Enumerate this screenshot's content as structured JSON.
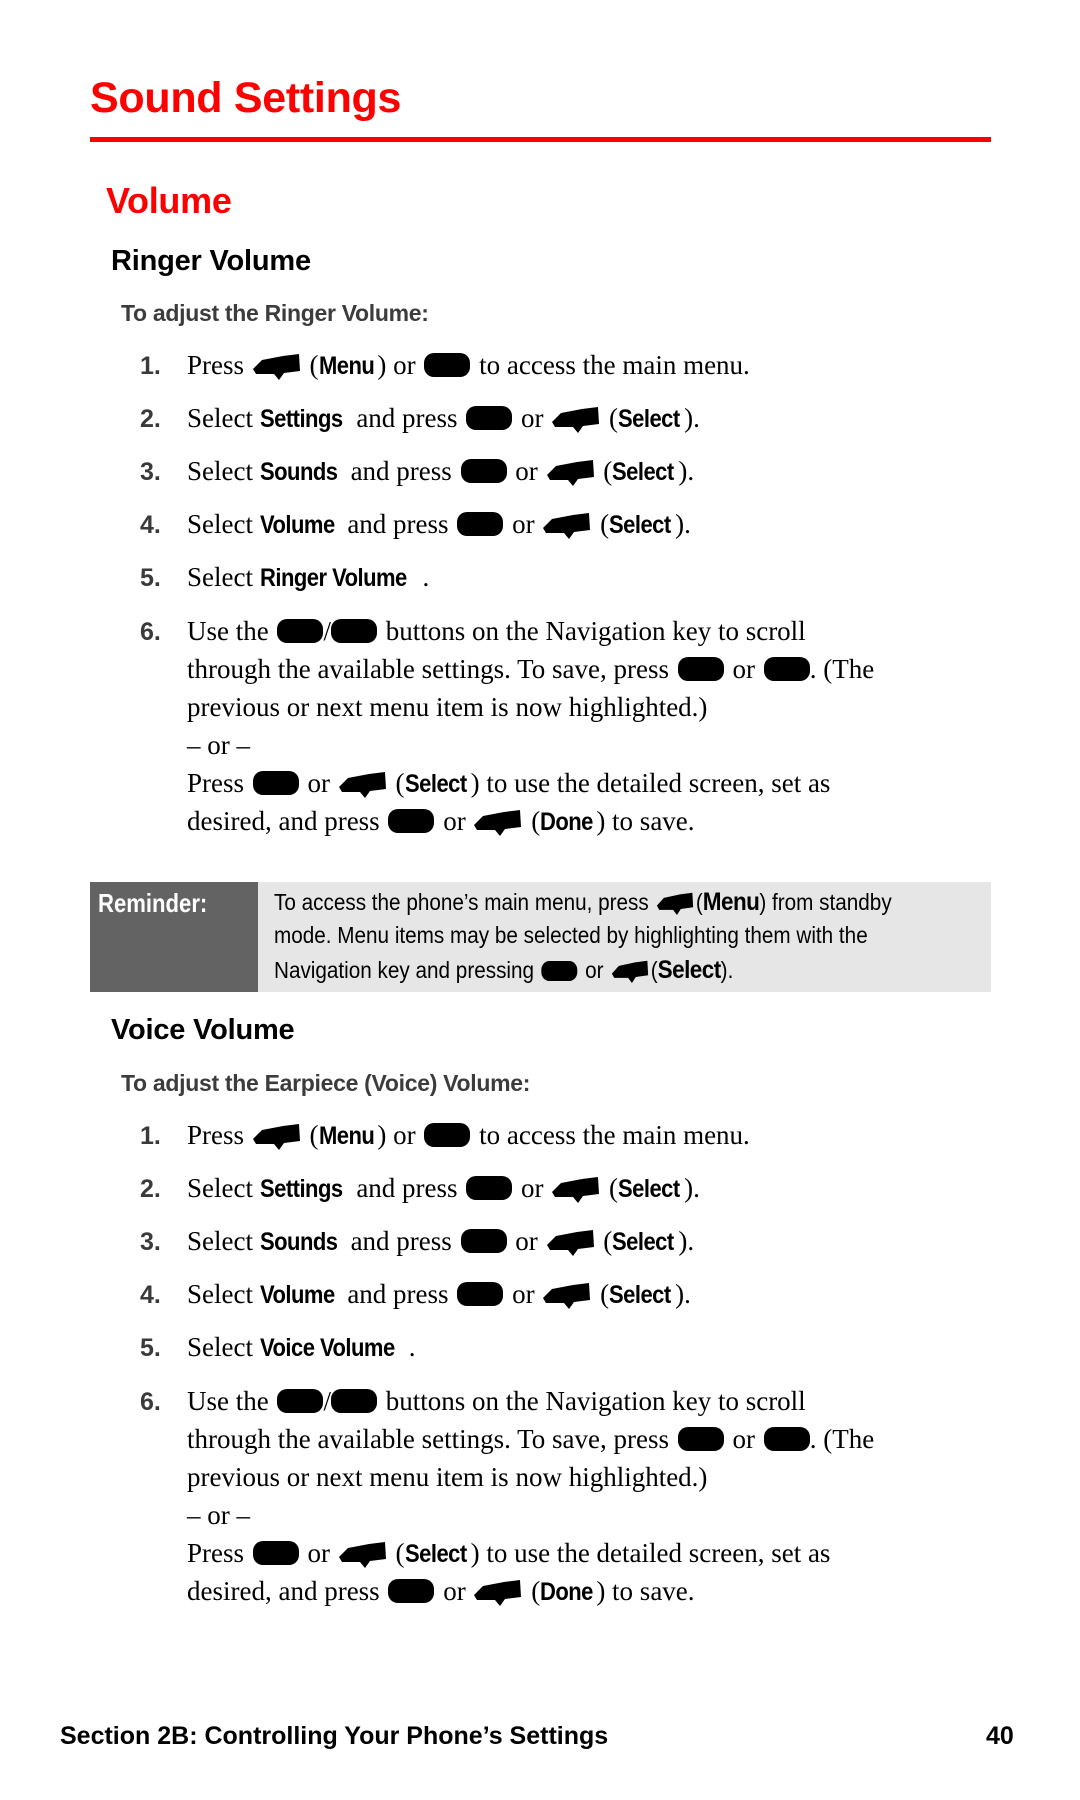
{
  "page": {
    "title": "Sound Settings",
    "accent_color": "#ff0000",
    "section_heading": "Volume"
  },
  "ringer": {
    "heading": "Ringer Volume",
    "subheading": "To adjust the Ringer Volume:",
    "steps": [
      {
        "num": "1.",
        "pre": "Press",
        "menu_label": "Menu",
        "mid": "or",
        "post": "to access the main menu."
      },
      {
        "num": "2.",
        "pre": "Select",
        "item": "Settings",
        "mid": "and press",
        "or": "or",
        "select_label": "Select"
      },
      {
        "num": "3.",
        "pre": "Select",
        "item": "Sounds",
        "mid": "and press",
        "or": "or",
        "select_label": "Select"
      },
      {
        "num": "4.",
        "pre": "Select",
        "item": "Volume",
        "mid": "and press",
        "or": "or",
        "select_label": "Select"
      },
      {
        "num": "5.",
        "pre": "Select",
        "item": "Ringer Volume"
      },
      {
        "num": "6.",
        "line1_pre": "Use the",
        "line1_post": "buttons on the Navigation key to scroll",
        "line2_pre": "through the available settings. To save, press",
        "line2_or": "or",
        "line2_post": ". (The",
        "line3": "previous or next menu item is now highlighted.)",
        "line4": "– or –",
        "line5_pre": "Press",
        "line5_or": "or",
        "line5_select": "Select",
        "line5_post": ") to use the detailed screen, set as",
        "line6_pre": "desired, and press",
        "line6_or": "or",
        "line6_done": "Done",
        "line6_post": ") to save."
      }
    ]
  },
  "reminder": {
    "label": "Reminder:",
    "line1_pre": "To access the phone’s main menu, press",
    "line1_menu": "Menu",
    "line1_post": ") from standby",
    "line2": "mode. Menu items may be selected by highlighting them with the",
    "line3_pre": "Navigation key and pressing",
    "line3_or": "or",
    "line3_select": "Select",
    "line3_post": ")."
  },
  "voice": {
    "heading": "Voice Volume",
    "subheading": "To adjust the Earpiece (Voice) Volume:",
    "steps": [
      {
        "num": "1.",
        "pre": "Press",
        "menu_label": "Menu",
        "mid": "or",
        "post": "to access the main menu."
      },
      {
        "num": "2.",
        "pre": "Select",
        "item": "Settings",
        "mid": "and press",
        "or": "or",
        "select_label": "Select"
      },
      {
        "num": "3.",
        "pre": "Select",
        "item": "Sounds",
        "mid": "and press",
        "or": "or",
        "select_label": "Select"
      },
      {
        "num": "4.",
        "pre": "Select",
        "item": "Volume",
        "mid": "and press",
        "or": "or",
        "select_label": "Select"
      },
      {
        "num": "5.",
        "pre": "Select",
        "item": "Voice Volume"
      },
      {
        "num": "6.",
        "line1_pre": "Use the",
        "line1_post": "buttons on the Navigation key to scroll",
        "line2_pre": "through the available settings. To save, press",
        "line2_or": "or",
        "line2_post": ". (The",
        "line3": "previous or next menu item is now highlighted.)",
        "line4": "– or –",
        "line5_pre": "Press",
        "line5_or": "or",
        "line5_select": "Select",
        "line5_post": ") to use the detailed screen, set as",
        "line6_pre": "desired, and press",
        "line6_or": "or",
        "line6_done": "Done",
        "line6_post": ") to save."
      }
    ]
  },
  "footer": {
    "section": "Section 2B: Controlling Your Phone’s Settings",
    "page_number": "40"
  },
  "icons": {
    "softkey": "left-softkey-icon",
    "menu_ok": "menu-ok-key-icon",
    "nav_up": "navigation-up-key-icon",
    "nav_down": "navigation-down-key-icon"
  }
}
